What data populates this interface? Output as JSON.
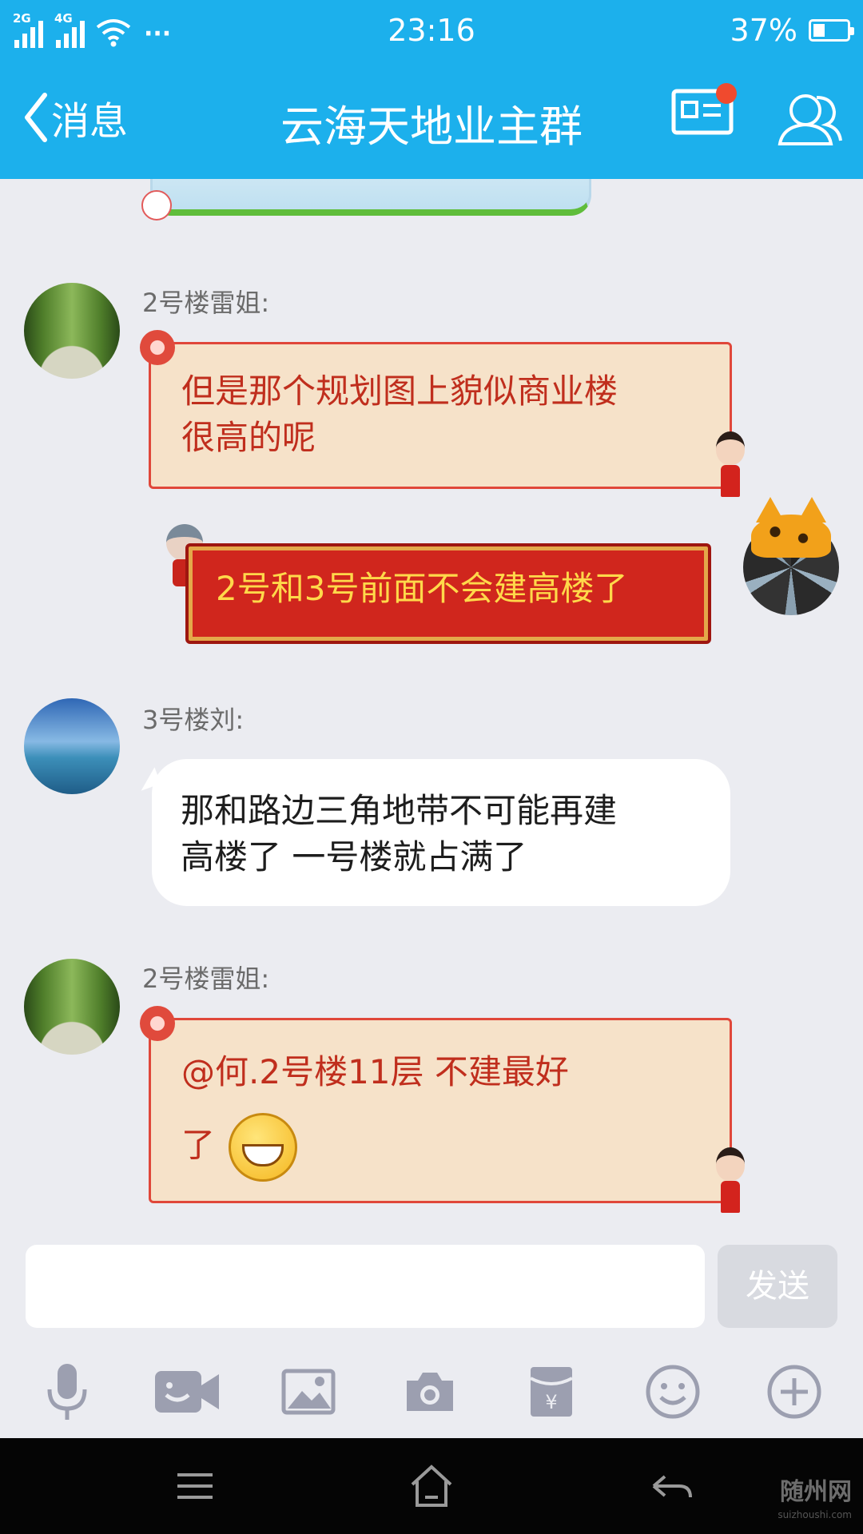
{
  "status_bar": {
    "signal1": "2G",
    "signal2": "4G",
    "more": "···",
    "time": "23:16",
    "battery": "37%",
    "battery_level": 0.37
  },
  "nav": {
    "back_label": "消息",
    "title": "云海天地业主群",
    "icons": [
      "contact-card-icon",
      "group-members-icon"
    ]
  },
  "messages": [
    {
      "sender": "2号楼雷姐:",
      "text_lines": [
        "但是那个规划图上貌似商业楼",
        "很高的呢"
      ],
      "style": "cream-bubble"
    },
    {
      "sender": "",
      "text_lines": [
        "2号和3号前面不会建高楼了"
      ],
      "style": "red-bubble",
      "mine": true
    },
    {
      "sender": "3号楼刘:",
      "text_lines": [
        "那和路边三角地带不可能再建",
        "高楼了 一号楼就占满了"
      ],
      "style": "white-bubble"
    },
    {
      "sender": "2号楼雷姐:",
      "text_lines": [
        "@何.2号楼11层 不建最好",
        "了"
      ],
      "style": "cream-bubble",
      "emoji": "grin-emoji"
    }
  ],
  "input": {
    "placeholder": "",
    "send_label": "发送"
  },
  "toolbar": [
    "microphone-icon",
    "video-icon",
    "image-icon",
    "camera-icon",
    "red-packet-icon",
    "emoji-icon",
    "plus-icon"
  ],
  "colors": {
    "header": "#1cb0ec",
    "background": "#ebecf1",
    "cream_bubble_text": "#c02e1d",
    "red_bubble_text": "#ffd94a"
  },
  "watermark": {
    "title": "随州网",
    "url": "suizhoushi.com"
  }
}
